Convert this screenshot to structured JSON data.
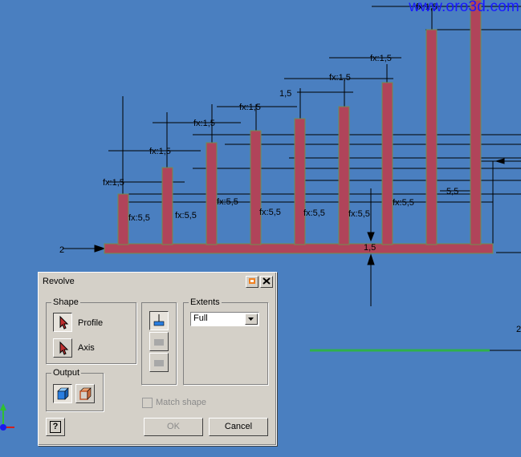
{
  "watermark": "www.oro3d.com",
  "dimensions": {
    "fx_1_5": "fx:1,5",
    "fx_5_5": "fx:5,5",
    "d_1_5": "1,5",
    "d_5_5": "5,5",
    "d_2": "2",
    "d_edge_2": "2"
  },
  "dialog": {
    "title": "Revolve",
    "shape": {
      "legend": "Shape",
      "profile_label": "Profile",
      "axis_label": "Axis"
    },
    "output": {
      "legend": "Output"
    },
    "extents": {
      "legend": "Extents",
      "value": "Full"
    },
    "match_shape_label": "Match shape",
    "ok_label": "OK",
    "cancel_label": "Cancel",
    "help_label": "?"
  },
  "colors": {
    "background": "#4a7fc0",
    "profile_fill": "#b0445a",
    "axis_line": "#2fb04a",
    "watermark": "#1a1aff"
  },
  "icons": [
    "select-arrow-icon",
    "solid-output-icon",
    "surface-output-icon",
    "direction-icon",
    "close-icon",
    "help-icon"
  ]
}
